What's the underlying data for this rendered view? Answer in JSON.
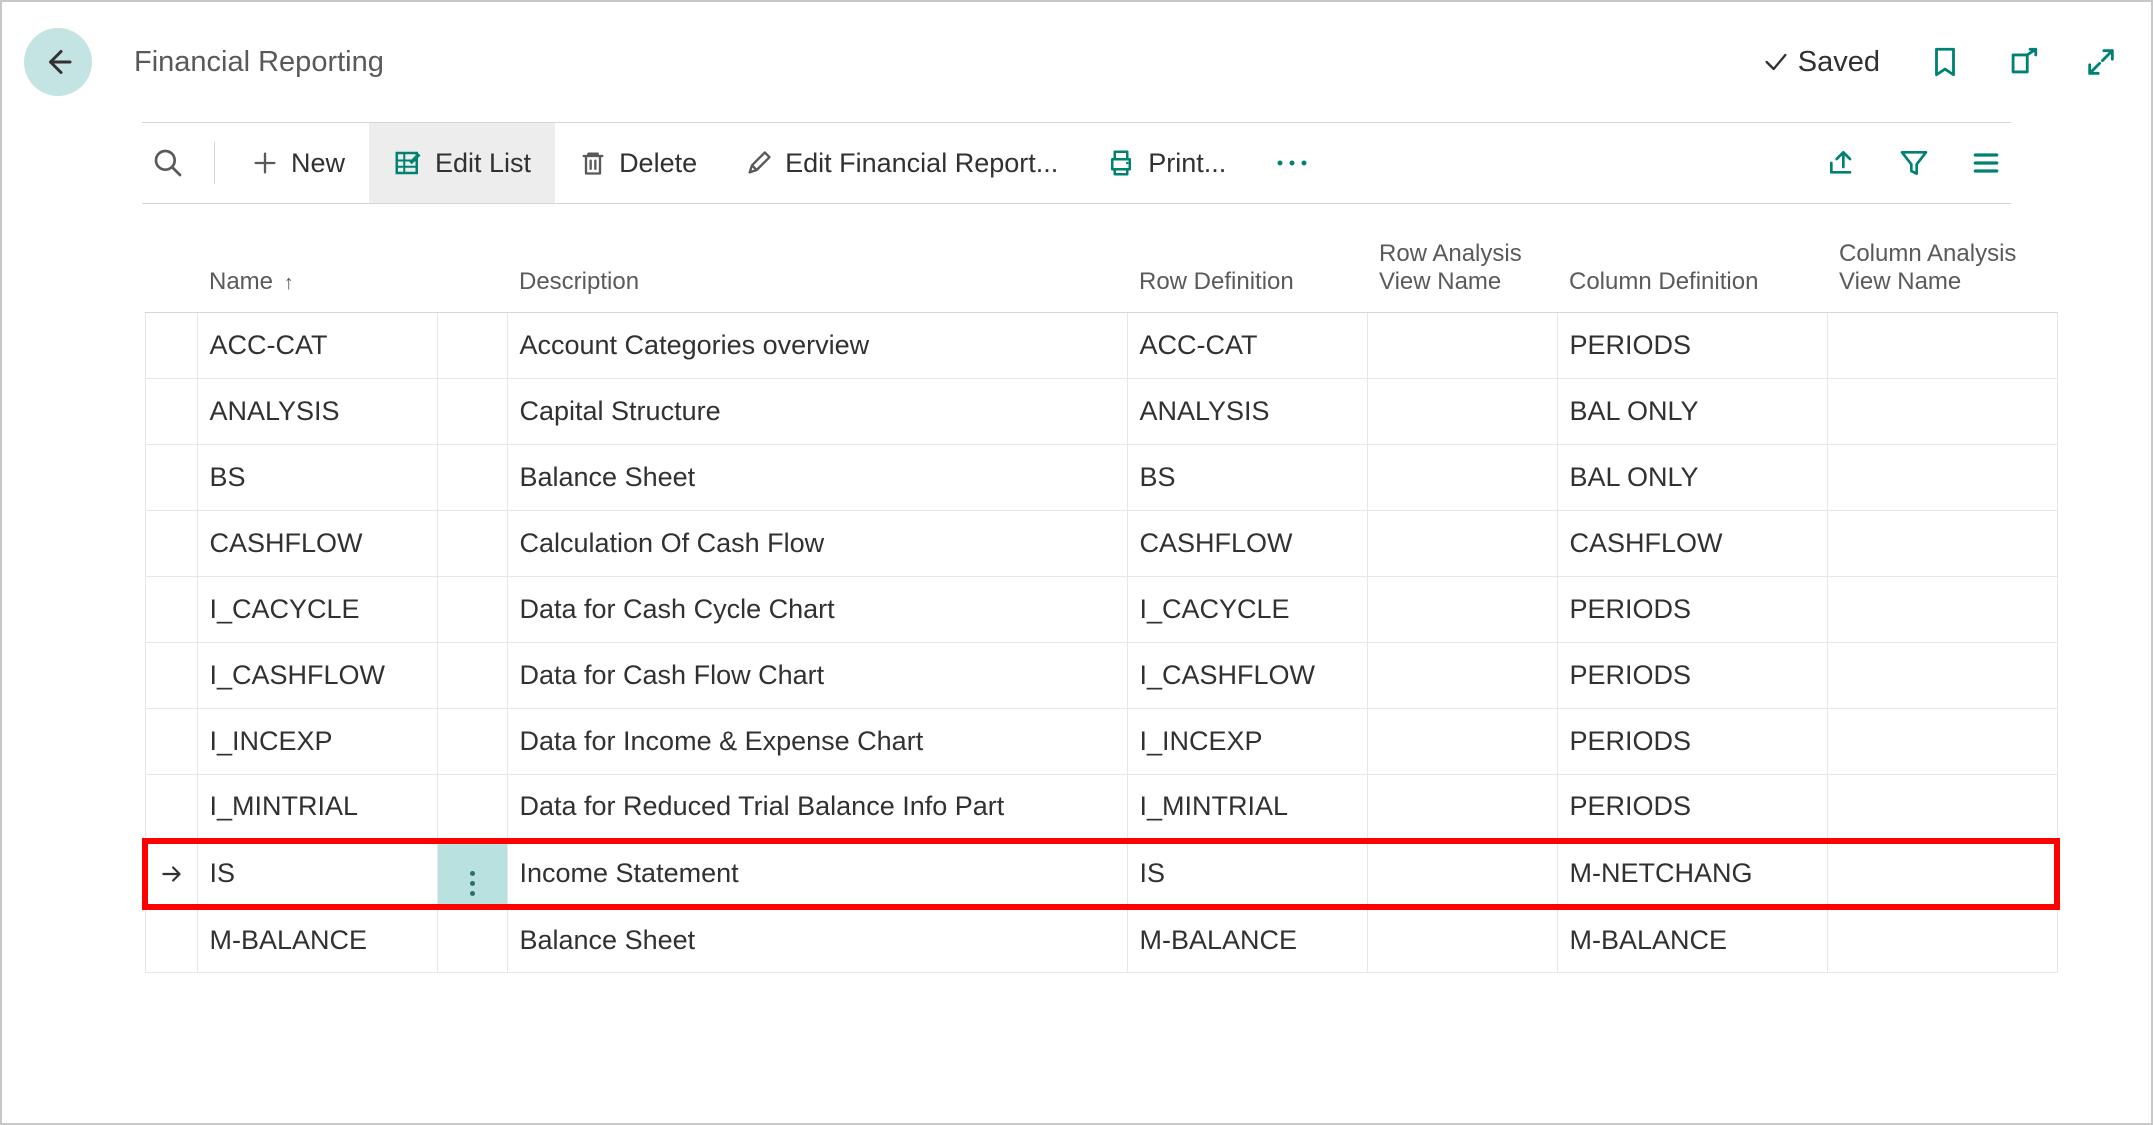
{
  "header": {
    "title": "Financial Reporting",
    "saved_label": "Saved"
  },
  "toolbar": {
    "new_label": "New",
    "edit_list_label": "Edit List",
    "delete_label": "Delete",
    "edit_report_label": "Edit Financial Report...",
    "print_label": "Print..."
  },
  "columns": {
    "name": "Name",
    "sort_indicator": "↑",
    "description": "Description",
    "row_definition": "Row Definition",
    "row_analysis_view_name": "Row Analysis View Name",
    "column_definition": "Column Definition",
    "column_analysis_view_name": "Column Analysis View Name"
  },
  "rows": [
    {
      "name": "ACC-CAT",
      "description": "Account Categories overview",
      "row_def": "ACC-CAT",
      "ravn": "",
      "col_def": "PERIODS",
      "cavn": "",
      "selected": false
    },
    {
      "name": "ANALYSIS",
      "description": "Capital Structure",
      "row_def": "ANALYSIS",
      "ravn": "",
      "col_def": "BAL ONLY",
      "cavn": "",
      "selected": false
    },
    {
      "name": "BS",
      "description": "Balance Sheet",
      "row_def": "BS",
      "ravn": "",
      "col_def": "BAL ONLY",
      "cavn": "",
      "selected": false
    },
    {
      "name": "CASHFLOW",
      "description": "Calculation Of Cash Flow",
      "row_def": "CASHFLOW",
      "ravn": "",
      "col_def": "CASHFLOW",
      "cavn": "",
      "selected": false
    },
    {
      "name": "I_CACYCLE",
      "description": "Data for Cash Cycle Chart",
      "row_def": "I_CACYCLE",
      "ravn": "",
      "col_def": "PERIODS",
      "cavn": "",
      "selected": false
    },
    {
      "name": "I_CASHFLOW",
      "description": "Data for Cash Flow Chart",
      "row_def": "I_CASHFLOW",
      "ravn": "",
      "col_def": "PERIODS",
      "cavn": "",
      "selected": false
    },
    {
      "name": "I_INCEXP",
      "description": "Data for Income & Expense Chart",
      "row_def": "I_INCEXP",
      "ravn": "",
      "col_def": "PERIODS",
      "cavn": "",
      "selected": false
    },
    {
      "name": "I_MINTRIAL",
      "description": "Data for Reduced Trial Balance Info Part",
      "row_def": "I_MINTRIAL",
      "ravn": "",
      "col_def": "PERIODS",
      "cavn": "",
      "selected": false
    },
    {
      "name": "IS",
      "description": "Income Statement",
      "row_def": "IS",
      "ravn": "",
      "col_def": "M-NETCHANG",
      "cavn": "",
      "selected": true
    },
    {
      "name": "M-BALANCE",
      "description": "Balance Sheet",
      "row_def": "M-BALANCE",
      "ravn": "",
      "col_def": "M-BALANCE",
      "cavn": "",
      "selected": false
    }
  ]
}
